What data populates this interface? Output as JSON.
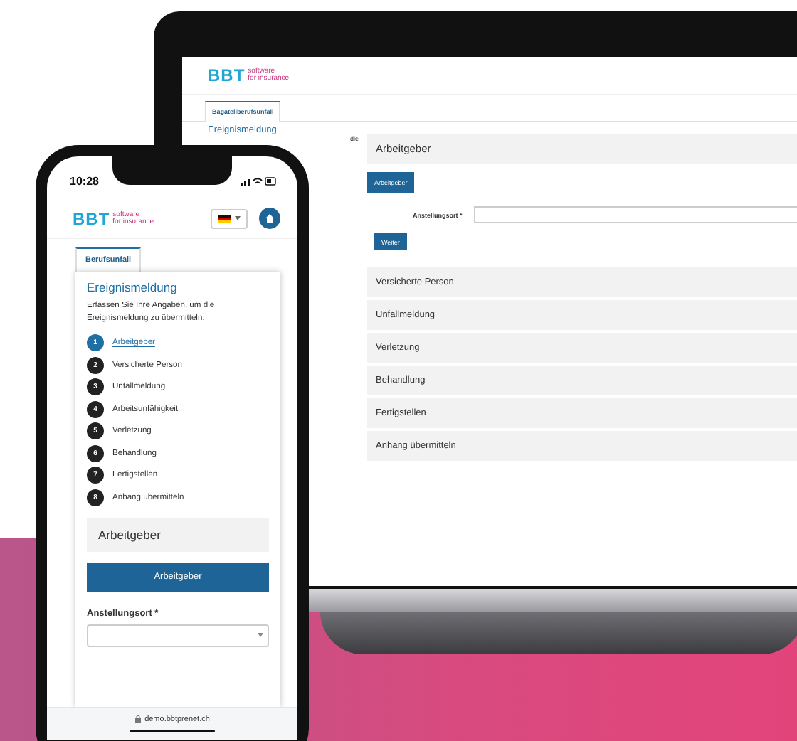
{
  "laptop": {
    "logo": {
      "mark": "BBT",
      "tagline_1": "software",
      "tagline_2": "for insurance"
    },
    "tabs": [
      {
        "label": "Bagatellberufsunfall",
        "selected": true
      }
    ],
    "sidebar": {
      "title": "Ereignismeldung",
      "text_fragment": "die"
    },
    "current_section": {
      "title": "Arbeitgeber",
      "button": "Arbeitgeber",
      "field": {
        "label": "Anstellungsort *"
      },
      "next_button": "Weiter"
    },
    "sections": [
      "Versicherte Person",
      "Unfallmeldung",
      "Verletzung",
      "Behandlung",
      "Fertigstellen",
      "Anhang übermitteln"
    ]
  },
  "phone": {
    "status_bar": {
      "time": "10:28"
    },
    "logo": {
      "mark": "BBT",
      "tagline_1": "software",
      "tagline_2": "for insurance"
    },
    "tabs": [
      {
        "label": "Berufsunfall",
        "selected": true
      }
    ],
    "card": {
      "title": "Ereignismeldung",
      "description": "Erfassen Sie Ihre Angaben, um die Ereignismeldung zu übermitteln.",
      "steps": [
        {
          "number": "1",
          "label": "Arbeitgeber",
          "selected": true
        },
        {
          "number": "2",
          "label": "Versicherte Person",
          "selected": false
        },
        {
          "number": "3",
          "label": "Unfallmeldung",
          "selected": false
        },
        {
          "number": "4",
          "label": "Arbeitsunfähigkeit",
          "selected": false
        },
        {
          "number": "5",
          "label": "Verletzung",
          "selected": false
        },
        {
          "number": "6",
          "label": "Behandlung",
          "selected": false
        },
        {
          "number": "7",
          "label": "Fertigstellen",
          "selected": false
        },
        {
          "number": "8",
          "label": "Anhang übermitteln",
          "selected": false
        }
      ],
      "current_section": {
        "title": "Arbeitgeber",
        "button": "Arbeitgeber",
        "field": {
          "label": "Anstellungsort *"
        }
      }
    },
    "url_bar": {
      "url": "demo.bbtprenet.ch"
    }
  }
}
